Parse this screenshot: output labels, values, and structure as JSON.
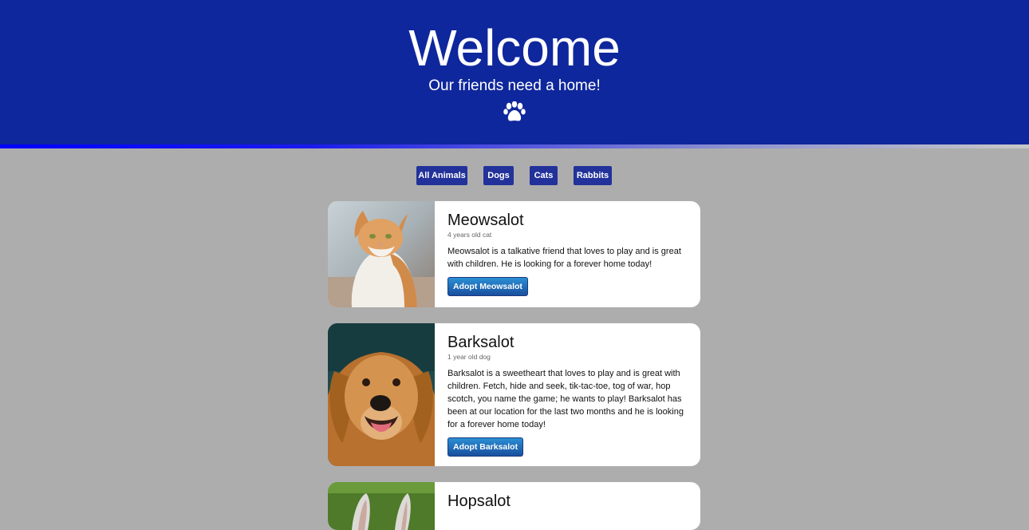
{
  "header": {
    "title": "Welcome",
    "subtitle": "Our friends need a home!",
    "icon": "paw-icon"
  },
  "filters": [
    "All Animals",
    "Dogs",
    "Cats",
    "Rabbits"
  ],
  "colors": {
    "header_bg": "#0f279c",
    "page_bg": "#adadad",
    "filter_bg": "#22329a",
    "adopt_top": "#2a8fd4",
    "adopt_bottom": "#1a4f9e"
  },
  "pets": [
    {
      "name": "Meowsalot",
      "meta": "4 years old cat",
      "description": "Meowsalot is a talkative friend that loves to play and is great with children. He is looking for a forever home today!",
      "button": "Adopt Meowsalot"
    },
    {
      "name": "Barksalot",
      "meta": "1 year old dog",
      "description": "Barksalot is a sweetheart that loves to play and is great with children. Fetch, hide and seek, tik-tac-toe, tog of war, hop scotch, you name the game; he wants to play! Barksalot has been at our location for the last two months and he is looking for a forever home today!",
      "button": "Adopt Barksalot"
    },
    {
      "name": "Hopsalot"
    }
  ]
}
